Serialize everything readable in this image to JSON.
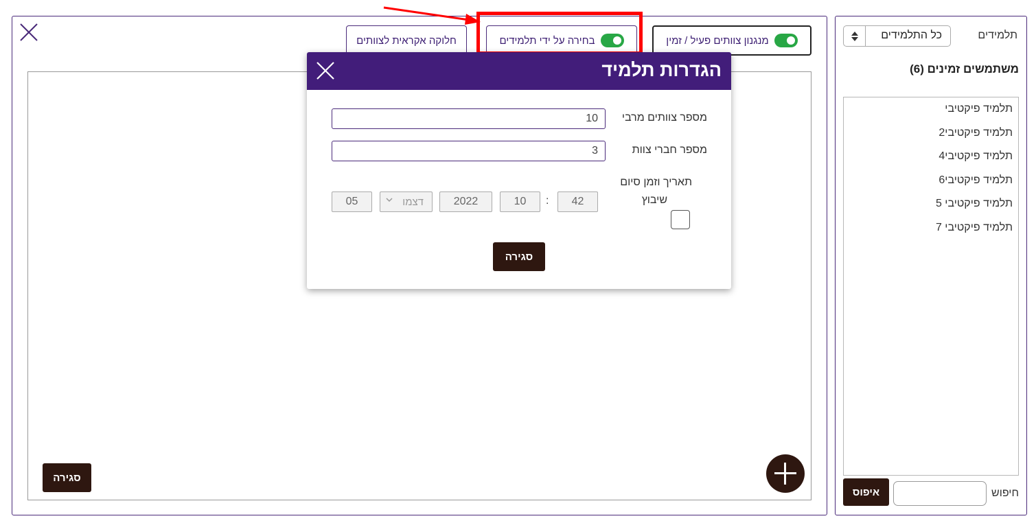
{
  "sidebar": {
    "students_label": "תלמידים",
    "filter_value": "כל התלמידים",
    "temp_users_title": "משתמשים זמינים (6)",
    "students": [
      "תלמיד פיקטיבי",
      "תלמיד פיקטיבי2",
      "תלמיד פיקטיבי4",
      "תלמיד פיקטיבי6",
      "תלמיד פיקטיבי 5",
      "תלמיד פיקטיבי 7"
    ],
    "search_label": "חיפוש",
    "search_value": "",
    "reset_label": "איפוס"
  },
  "toolbar": {
    "active_mechanism_label": "מנגנון צוותים פעיל / זמין",
    "student_choice_label": "בחירה על ידי תלמידים",
    "random_split_label": "חלוקה אקראית לצוותים"
  },
  "main": {
    "close_label": "סגירה"
  },
  "modal": {
    "title": "הגדרות תלמיד",
    "max_teams_label": "מספר צוותים מרבי",
    "max_teams_value": "10",
    "team_members_label": "מספר חברי צוות",
    "team_members_value": "3",
    "end_datetime_label": "תאריך וזמן סיום",
    "day": "05",
    "month_placeholder": "דצמו",
    "year": "2022",
    "hour": "10",
    "minute": "42",
    "time_separator": ":",
    "assignment_label": "שיבוץ",
    "close_label": "סגירה"
  },
  "colors": {
    "header_purple": "#421d7a",
    "border_purple": "#4a2a7a",
    "button_brown": "#2e1710",
    "toggle_green": "#28a745",
    "highlight_red": "#ff0000"
  }
}
